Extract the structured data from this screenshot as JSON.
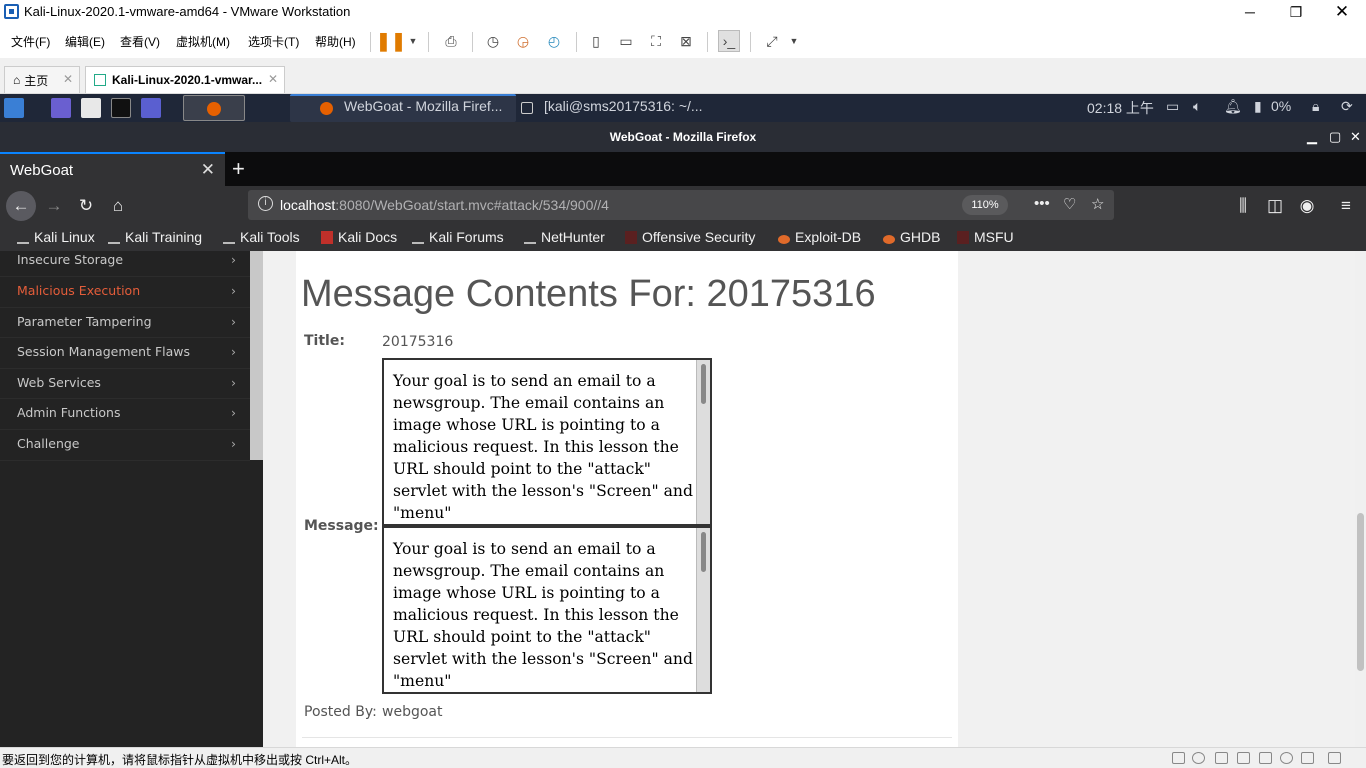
{
  "vmware": {
    "title": "Kali-Linux-2020.1-vmware-amd64 - VMware Workstation",
    "menu": [
      "文件(F)",
      "编辑(E)",
      "查看(V)",
      "虚拟机(M)",
      "选项卡(T)",
      "帮助(H)"
    ],
    "tabs": [
      {
        "label": "主页",
        "icon": "home-icon"
      },
      {
        "label": "Kali-Linux-2020.1-vmwar...",
        "icon": "vm-icon"
      }
    ],
    "status_message": "要返回到您的计算机，请将鼠标指针从虚拟机中移出或按 Ctrl+Alt。"
  },
  "kali_panel": {
    "task_firefox": "WebGoat - Mozilla Firef...",
    "task_terminal": "[kali@sms20175316: ~/...",
    "clock": "02:18 上午",
    "battery": "0%"
  },
  "firefox": {
    "window_title": "WebGoat - Mozilla Firefox",
    "tab_title": "WebGoat",
    "url_host": "localhost",
    "url_rest": ":8080/WebGoat/start.mvc#attack/534/900//4",
    "zoom": "110%",
    "bookmarks": [
      "Kali Linux",
      "Kali Training",
      "Kali Tools",
      "Kali Docs",
      "Kali Forums",
      "NetHunter",
      "Offensive Security",
      "Exploit-DB",
      "GHDB",
      "MSFU"
    ]
  },
  "sidebar": {
    "items": [
      {
        "label": "Insecure Storage",
        "active": false
      },
      {
        "label": "Malicious Execution",
        "active": true
      },
      {
        "label": "Parameter Tampering",
        "active": false
      },
      {
        "label": "Session Management Flaws",
        "active": false
      },
      {
        "label": "Web Services",
        "active": false
      },
      {
        "label": "Admin Functions",
        "active": false
      },
      {
        "label": "Challenge",
        "active": false
      }
    ],
    "chevron": "›"
  },
  "message": {
    "heading": "Message Contents For: 20175316",
    "title_label": "Title:",
    "title_value": "20175316",
    "message_label": "Message:",
    "body": "Your goal is to send an email to a newsgroup. The email contains an image whose URL is pointing to a malicious request. In this lesson the URL should point to the \"attack\" servlet with the lesson's \"Screen\" and \"menu\"",
    "posted_by_label": "Posted By:",
    "posted_by_value": "webgoat"
  }
}
